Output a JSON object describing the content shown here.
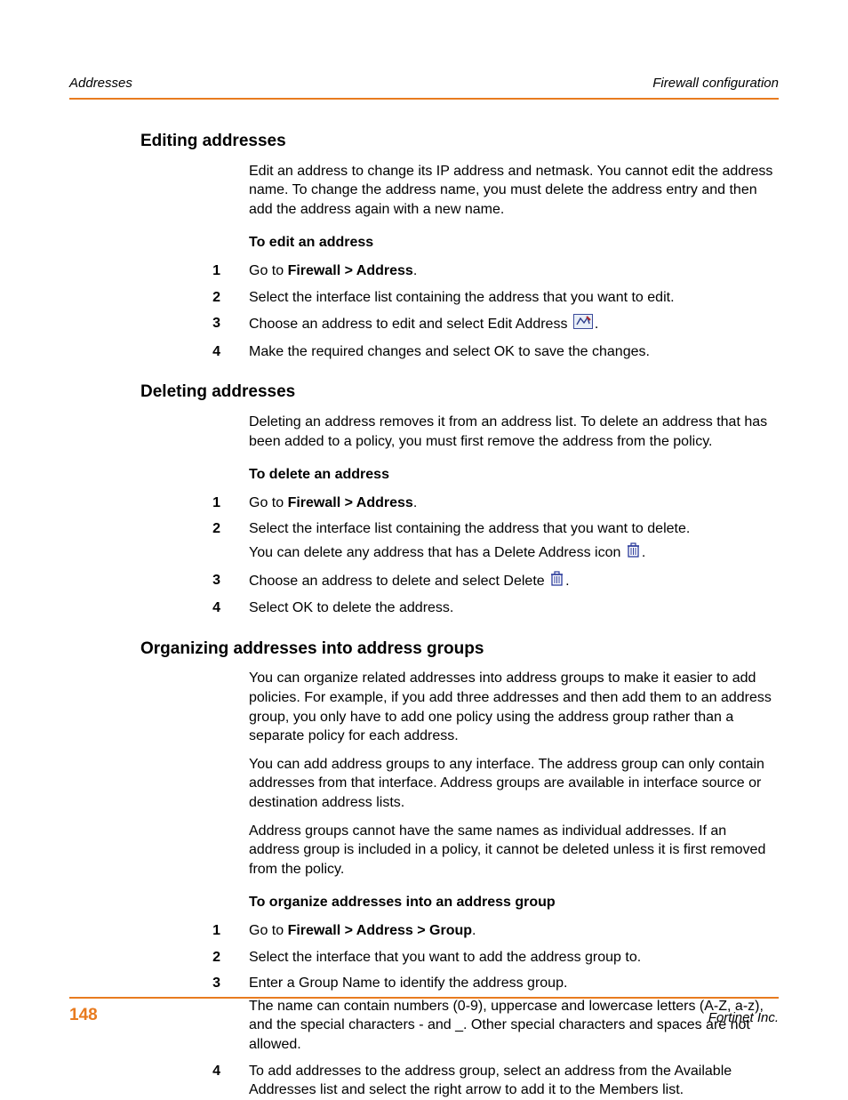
{
  "header": {
    "left": "Addresses",
    "right": "Firewall configuration"
  },
  "footer": {
    "page": "148",
    "brand": "Fortinet Inc."
  },
  "sections": {
    "editing": {
      "title": "Editing addresses",
      "intro": "Edit an address to change its IP address and netmask. You cannot edit the address name. To change the address name, you must delete the address entry and then add the address again with a new name.",
      "task_title": "To edit an address",
      "steps": {
        "s1a": "Go to ",
        "s1b": "Firewall > Address",
        "s1c": ".",
        "s2": "Select the interface list containing the address that you want to edit.",
        "s3a": "Choose an address to edit and select Edit Address ",
        "s3b": ".",
        "s4": "Make the required changes and select OK to save the changes."
      }
    },
    "deleting": {
      "title": "Deleting addresses",
      "intro": "Deleting an address removes it from an address list. To delete an address that has been added to a policy, you must first remove the address from the policy.",
      "task_title": "To delete an address",
      "steps": {
        "s1a": "Go to ",
        "s1b": "Firewall > Address",
        "s1c": ".",
        "s2a": "Select the interface list containing the address that you want to delete.",
        "s2b": "You can delete any address that has a Delete Address icon ",
        "s2c": ".",
        "s3a": "Choose an address to delete and select Delete ",
        "s3b": ".",
        "s4": "Select OK to delete the address."
      }
    },
    "organizing": {
      "title": "Organizing addresses into address groups",
      "p1": "You can organize related addresses into address groups to make it easier to add policies. For example, if you add three addresses and then add them to an address group, you only have to add one policy using the address group rather than a separate policy for each address.",
      "p2": "You can add address groups to any interface. The address group can only contain addresses from that interface. Address groups are available in interface source or destination address lists.",
      "p3": "Address groups cannot have the same names as individual addresses. If an address group is included in a policy, it cannot be deleted unless it is first removed from the policy.",
      "task_title": "To organize addresses into an address group",
      "steps": {
        "s1a": "Go to ",
        "s1b": "Firewall > Address > Group",
        "s1c": ".",
        "s2": "Select the interface that you want to add the address group to.",
        "s3a": "Enter a Group Name to identify the address group.",
        "s3b": "The name can contain numbers (0-9), uppercase and lowercase letters (A-Z, a-z), and the special characters - and _. Other special characters and spaces are not allowed.",
        "s4": "To add addresses to the address group, select an address from the Available Addresses list and select the right arrow to add it to the Members list."
      }
    }
  },
  "nums": {
    "n1": "1",
    "n2": "2",
    "n3": "3",
    "n4": "4"
  }
}
